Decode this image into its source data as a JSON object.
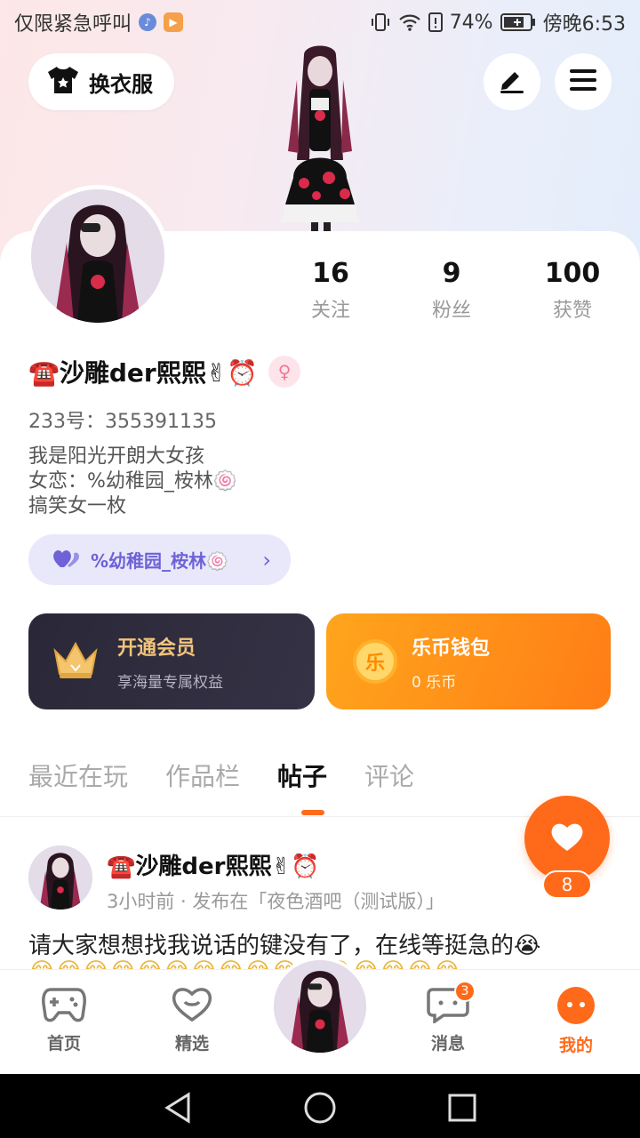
{
  "status_bar": {
    "carrier": "仅限紧急呼叫",
    "battery": "74%",
    "time": "傍晚6:53"
  },
  "header": {
    "dress_label": "换衣服"
  },
  "profile": {
    "stats": [
      {
        "value": "16",
        "label": "关注"
      },
      {
        "value": "9",
        "label": "粉丝"
      },
      {
        "value": "100",
        "label": "获赞"
      }
    ],
    "name": "☎️沙雕der熙熙✌⏰",
    "gender_symbol": "♀",
    "uid": "233号：355391135",
    "bio": [
      "我是阳光开朗大女孩",
      "女恋：%幼稚园_桉林🍥",
      "搞笑女一枚"
    ],
    "relation_pill": "%幼稚园_桉林🍥"
  },
  "cards": {
    "vip": {
      "title": "开通会员",
      "subtitle": "享海量专属权益"
    },
    "wallet": {
      "title": "乐币钱包",
      "subtitle": "0 乐币",
      "coin_char": "乐"
    }
  },
  "tabs": [
    "最近在玩",
    "作品栏",
    "帖子",
    "评论"
  ],
  "active_tab": "帖子",
  "post": {
    "author": "☎️沙雕der熙熙✌⏰",
    "meta": "3小时前 · 发布在「夜色酒吧（测试版）」",
    "text": "请大家想想找我说话的键没有了，在线等挺急的😭",
    "text_2": "😂😂😂😂😂😂😂😂😂😂😂😂😂😂😂😂",
    "like_count": "8"
  },
  "bottom_nav": [
    {
      "label": "首页",
      "icon": "gamepad-icon"
    },
    {
      "label": "精选",
      "icon": "heart-outline-icon"
    },
    {
      "label": "消息",
      "icon": "chat-bubble-icon",
      "badge": "3"
    },
    {
      "label": "我的",
      "icon": "profile-dots-icon"
    }
  ],
  "colors": {
    "accent": "#ff6a1a",
    "vip_gold": "#f2c47a",
    "pill_purple": "#6e62d6"
  }
}
